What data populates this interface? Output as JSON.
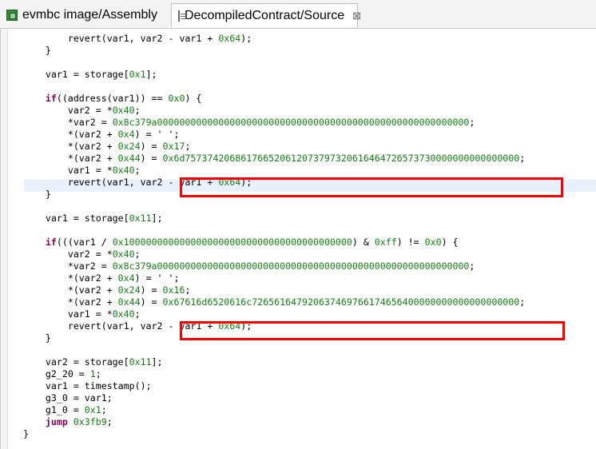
{
  "tabs": [
    {
      "label": "evmbc image/Assembly",
      "icon": "assembly-icon"
    },
    {
      "label": "DecompiledContract/Source",
      "icon": "source-file-icon",
      "close": "⊠"
    }
  ],
  "code": {
    "lines": [
      [
        [
          "        revert(var1, var2 - var1 + ",
          ""
        ],
        [
          "0x64",
          "num"
        ],
        [
          ");",
          ""
        ]
      ],
      [
        [
          "    }",
          ""
        ]
      ],
      [],
      [
        [
          "    var1 = storage[",
          ""
        ],
        [
          "0x1",
          "num"
        ],
        [
          "];",
          ""
        ]
      ],
      [],
      [
        [
          "    ",
          ""
        ],
        [
          "if",
          "kw"
        ],
        [
          "((address(var1)) == ",
          ""
        ],
        [
          "0x0",
          "num"
        ],
        [
          ") {",
          ""
        ]
      ],
      [
        [
          "        var2 = *",
          ""
        ],
        [
          "0x40",
          "num"
        ],
        [
          ";",
          ""
        ]
      ],
      [
        [
          "        *var2 = ",
          ""
        ],
        [
          "0x8c379a00000000000000000000000000000000000000000000000000000000",
          "num"
        ],
        [
          ";",
          ""
        ]
      ],
      [
        [
          "        *(var2 + ",
          ""
        ],
        [
          "0x4",
          "num"
        ],
        [
          ") = ' ';",
          ""
        ]
      ],
      [
        [
          "        *(var2 + ",
          ""
        ],
        [
          "0x24",
          "num"
        ],
        [
          ") = ",
          ""
        ],
        [
          "0x17",
          "num"
        ],
        [
          ";",
          ""
        ]
      ],
      [
        [
          "        *(var2 + ",
          ""
        ],
        [
          "0x44",
          "num"
        ],
        [
          ") = ",
          ""
        ],
        [
          "0x6d757374206861766520612073797320616464726573730000000000000000",
          "num"
        ],
        [
          ";",
          ""
        ]
      ],
      [
        [
          "        var1 = *",
          ""
        ],
        [
          "0x40",
          "num"
        ],
        [
          ";",
          ""
        ]
      ],
      [
        [
          "        revert(var1, var2 - var1 + ",
          ""
        ],
        [
          "0x64",
          "num"
        ],
        [
          ");",
          ""
        ]
      ],
      [
        [
          "    }",
          ""
        ]
      ],
      [],
      [
        [
          "    var1 = storage[",
          ""
        ],
        [
          "0x11",
          "num"
        ],
        [
          "];",
          ""
        ]
      ],
      [],
      [
        [
          "    ",
          ""
        ],
        [
          "if",
          "kw"
        ],
        [
          "(((var1 / ",
          ""
        ],
        [
          "0x10000000000000000000000000000000000000000",
          "num"
        ],
        [
          ") & ",
          ""
        ],
        [
          "0xff",
          "num"
        ],
        [
          ") != ",
          ""
        ],
        [
          "0x0",
          "num"
        ],
        [
          ") {",
          ""
        ]
      ],
      [
        [
          "        var2 = *",
          ""
        ],
        [
          "0x40",
          "num"
        ],
        [
          ";",
          ""
        ]
      ],
      [
        [
          "        *var2 = ",
          ""
        ],
        [
          "0x8c379a00000000000000000000000000000000000000000000000000000000",
          "num"
        ],
        [
          ";",
          ""
        ]
      ],
      [
        [
          "        *(var2 + ",
          ""
        ],
        [
          "0x4",
          "num"
        ],
        [
          ") = ' ';",
          ""
        ]
      ],
      [
        [
          "        *(var2 + ",
          ""
        ],
        [
          "0x24",
          "num"
        ],
        [
          ") = ",
          ""
        ],
        [
          "0x16",
          "num"
        ],
        [
          ";",
          ""
        ]
      ],
      [
        [
          "        *(var2 + ",
          ""
        ],
        [
          "0x44",
          "num"
        ],
        [
          ") = ",
          ""
        ],
        [
          "0x67616d6520616c726561647920637469766174656400000000000000000000",
          "num"
        ],
        [
          ";",
          ""
        ]
      ],
      [
        [
          "        var1 = *",
          ""
        ],
        [
          "0x40",
          "num"
        ],
        [
          ";",
          ""
        ]
      ],
      [
        [
          "        revert(var1, var2 - var1 + ",
          ""
        ],
        [
          "0x64",
          "num"
        ],
        [
          ");",
          ""
        ]
      ],
      [
        [
          "    }",
          ""
        ]
      ],
      [],
      [
        [
          "    var2 = storage[",
          ""
        ],
        [
          "0x11",
          "num"
        ],
        [
          "];",
          ""
        ]
      ],
      [
        [
          "    g2_20 = ",
          ""
        ],
        [
          "1",
          "num"
        ],
        [
          ";",
          ""
        ]
      ],
      [
        [
          "    var1 = timestamp();",
          ""
        ]
      ],
      [
        [
          "    g3_0 = var1;",
          ""
        ]
      ],
      [
        [
          "    g1_0 = ",
          ""
        ],
        [
          "0x1",
          "num"
        ],
        [
          ";",
          ""
        ]
      ],
      [
        [
          "    ",
          ""
        ],
        [
          "jump",
          "kw"
        ],
        [
          " ",
          ""
        ],
        [
          "0x3fb9",
          "num"
        ],
        [
          ";",
          ""
        ]
      ],
      [
        [
          "}",
          ""
        ]
      ]
    ]
  },
  "colors": {
    "number": "#128012",
    "keyword": "#7f0055",
    "highlight_box": "#ff0000",
    "current_line": "#e8f0fb"
  }
}
